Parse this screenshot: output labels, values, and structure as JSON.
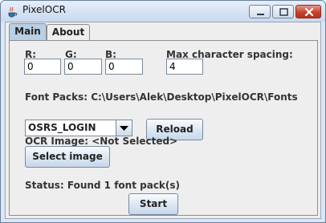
{
  "window": {
    "title": "PixelOCR",
    "controls": [
      "minimize",
      "maximize",
      "close"
    ]
  },
  "tabs": [
    {
      "label": "Main",
      "selected": true
    },
    {
      "label": "About",
      "selected": false
    }
  ],
  "main": {
    "rgb": {
      "r_label": "R:",
      "r_value": "0",
      "g_label": "G:",
      "g_value": "0",
      "b_label": "B:",
      "b_value": "0"
    },
    "spacing": {
      "label": "Max character spacing:",
      "value": "4"
    },
    "font_packs": {
      "label": "Font Packs: C:\\Users\\Alek\\Desktop\\PixelOCR\\Fonts",
      "selected": "OSRS_LOGIN",
      "reload_label": "Reload"
    },
    "ocr_image": {
      "label": "OCR Image: <Not Selected>",
      "select_label": "Select image"
    },
    "status": "Status: Found 1 font pack(s)",
    "start_label": "Start"
  }
}
